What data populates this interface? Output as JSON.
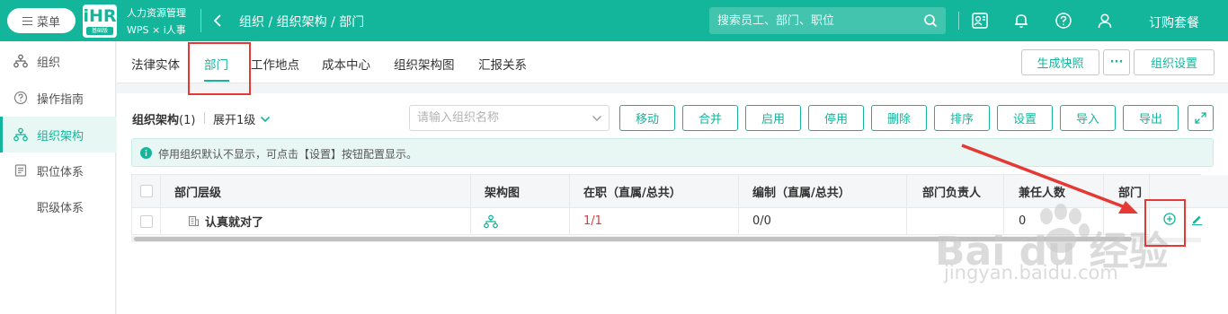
{
  "topbar": {
    "menu_label": "菜单",
    "logo_text": "iHR",
    "logo_sub": "基础版",
    "app_name": "人力资源管理",
    "app_sub": "WPS × i人事",
    "breadcrumb": "组织 / 组织架构 / 部门",
    "search_placeholder": "搜索员工、部门、职位",
    "subscribe": "订购套餐"
  },
  "sidebar": {
    "items": [
      {
        "label": "组织",
        "icon": "org-icon"
      },
      {
        "label": "操作指南",
        "icon": "help-icon"
      },
      {
        "label": "组织架构",
        "icon": "structure-icon"
      },
      {
        "label": "职位体系",
        "icon": "position-icon"
      },
      {
        "label": "职级体系",
        "icon": ""
      }
    ],
    "active_index": 2
  },
  "tabs": {
    "items": [
      "法律实体",
      "部门",
      "工作地点",
      "成本中心",
      "组织架构图",
      "汇报关系"
    ],
    "active_index": 1,
    "snapshot_label": "生成快照",
    "more_label": "···",
    "settings_label": "组织设置"
  },
  "toolbar": {
    "tree_title": "组织架构",
    "tree_count": "(1)",
    "expand_label": "展开1级",
    "org_search_placeholder": "请输入组织名称",
    "buttons": [
      "移动",
      "合并",
      "启用",
      "停用",
      "删除",
      "排序",
      "设置",
      "导入",
      "导出"
    ]
  },
  "notice": {
    "text": "停用组织默认不显示，可点击【设置】按钮配置显示。"
  },
  "table": {
    "headers": [
      "部门层级",
      "架构图",
      "在职（直属/总共）",
      "编制（直属/总共）",
      "部门负责人",
      "兼任人数",
      "部门"
    ],
    "row": {
      "name": "认真就对了",
      "in_service": "1/1",
      "establishment": "0/0",
      "head": "",
      "concurrent": "0",
      "dept": ""
    }
  },
  "watermark": {
    "logo": "Bai du 经验",
    "url": "jingyan.baidu.com"
  },
  "colors": {
    "primary": "#14b69b",
    "highlight": "#e53935"
  }
}
